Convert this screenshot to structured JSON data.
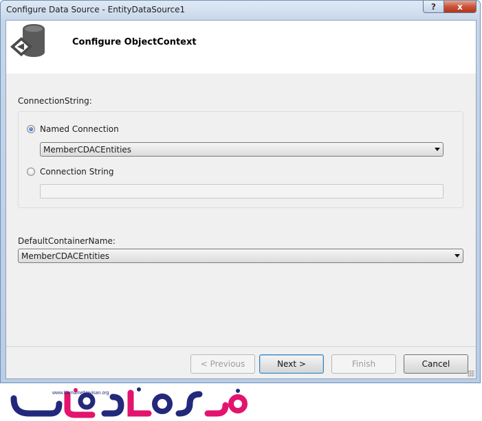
{
  "window": {
    "title": "Configure Data Source - EntityDataSource1",
    "help_symbol": "?",
    "close_symbol": "x"
  },
  "header": {
    "title": "Configure ObjectContext",
    "icon": "database-refresh-icon"
  },
  "connection": {
    "label": "ConnectionString:",
    "named_label": "Named Connection",
    "named_selected": true,
    "named_value": "MemberCDACEntities",
    "string_label": "Connection String",
    "string_value": ""
  },
  "container": {
    "label": "DefaultContainerName:",
    "value": "MemberCDACEntities"
  },
  "buttons": {
    "previous": "< Previous",
    "next": "Next >",
    "finish": "Finish",
    "cancel": "Cancel"
  },
  "watermark": {
    "text": "www.BarnameNevisan.org",
    "colors": {
      "pink": "#e2146d",
      "navy": "#23297a"
    }
  }
}
